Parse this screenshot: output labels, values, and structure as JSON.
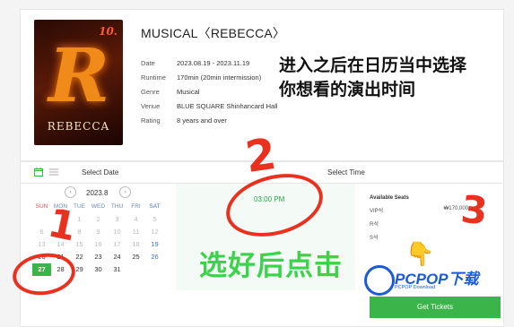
{
  "show": {
    "title": "MUSICAL〈REBECCA〉",
    "poster_text": "REBECCA",
    "poster_letter": "R",
    "poster_badge": "10.",
    "info": [
      {
        "label": "Date",
        "value": "2023.08.19 - 2023.11.19"
      },
      {
        "label": "Runtime",
        "value": "170min (20min intermission)"
      },
      {
        "label": "Genre",
        "value": "Musical"
      },
      {
        "label": "Venue",
        "value": "BLUE SQUARE Shinhancard Hall"
      },
      {
        "label": "Rating",
        "value": "8 years and over"
      }
    ]
  },
  "annotation": {
    "top_note_line1": "进入之后在日历当中选择",
    "top_note_line2": "你想看的演出时间",
    "bottom_note": "选好后点击",
    "num1": "1",
    "num2": "2",
    "num3": "3"
  },
  "booking": {
    "select_date_label": "Select Date",
    "select_time_label": "Select Time",
    "month": "2023.8",
    "prev": "‹",
    "next": "›",
    "weekdays": [
      "SUN",
      "MON",
      "TUE",
      "WED",
      "THU",
      "FRI",
      "SAT"
    ],
    "weeks": [
      [
        "",
        "",
        "1",
        "2",
        "3",
        "4",
        "5"
      ],
      [
        "6",
        "7",
        "8",
        "9",
        "10",
        "11",
        "12"
      ],
      [
        "13",
        "14",
        "15",
        "16",
        "17",
        "18",
        "19"
      ],
      [
        "20",
        "21",
        "22",
        "23",
        "24",
        "25",
        "26"
      ],
      [
        "27",
        "28",
        "29",
        "30",
        "31",
        "",
        ""
      ]
    ],
    "selected_day": "27",
    "time": "03:00 PM",
    "seats_title": "Available Seats",
    "seats": [
      {
        "grade": "VIP석",
        "price": "₩170,000"
      },
      {
        "grade": "R석",
        "price": ""
      },
      {
        "grade": "S석",
        "price": ""
      }
    ],
    "get_tickets": "Get Tickets"
  },
  "watermark": {
    "brand": "PCPOP下载",
    "sub": "PCPOP Download"
  },
  "colors": {
    "accent_green": "#3bb54a",
    "annotation_red": "#e8311f",
    "note_green": "#3cd24a",
    "brand_blue": "#1c5bd8"
  }
}
